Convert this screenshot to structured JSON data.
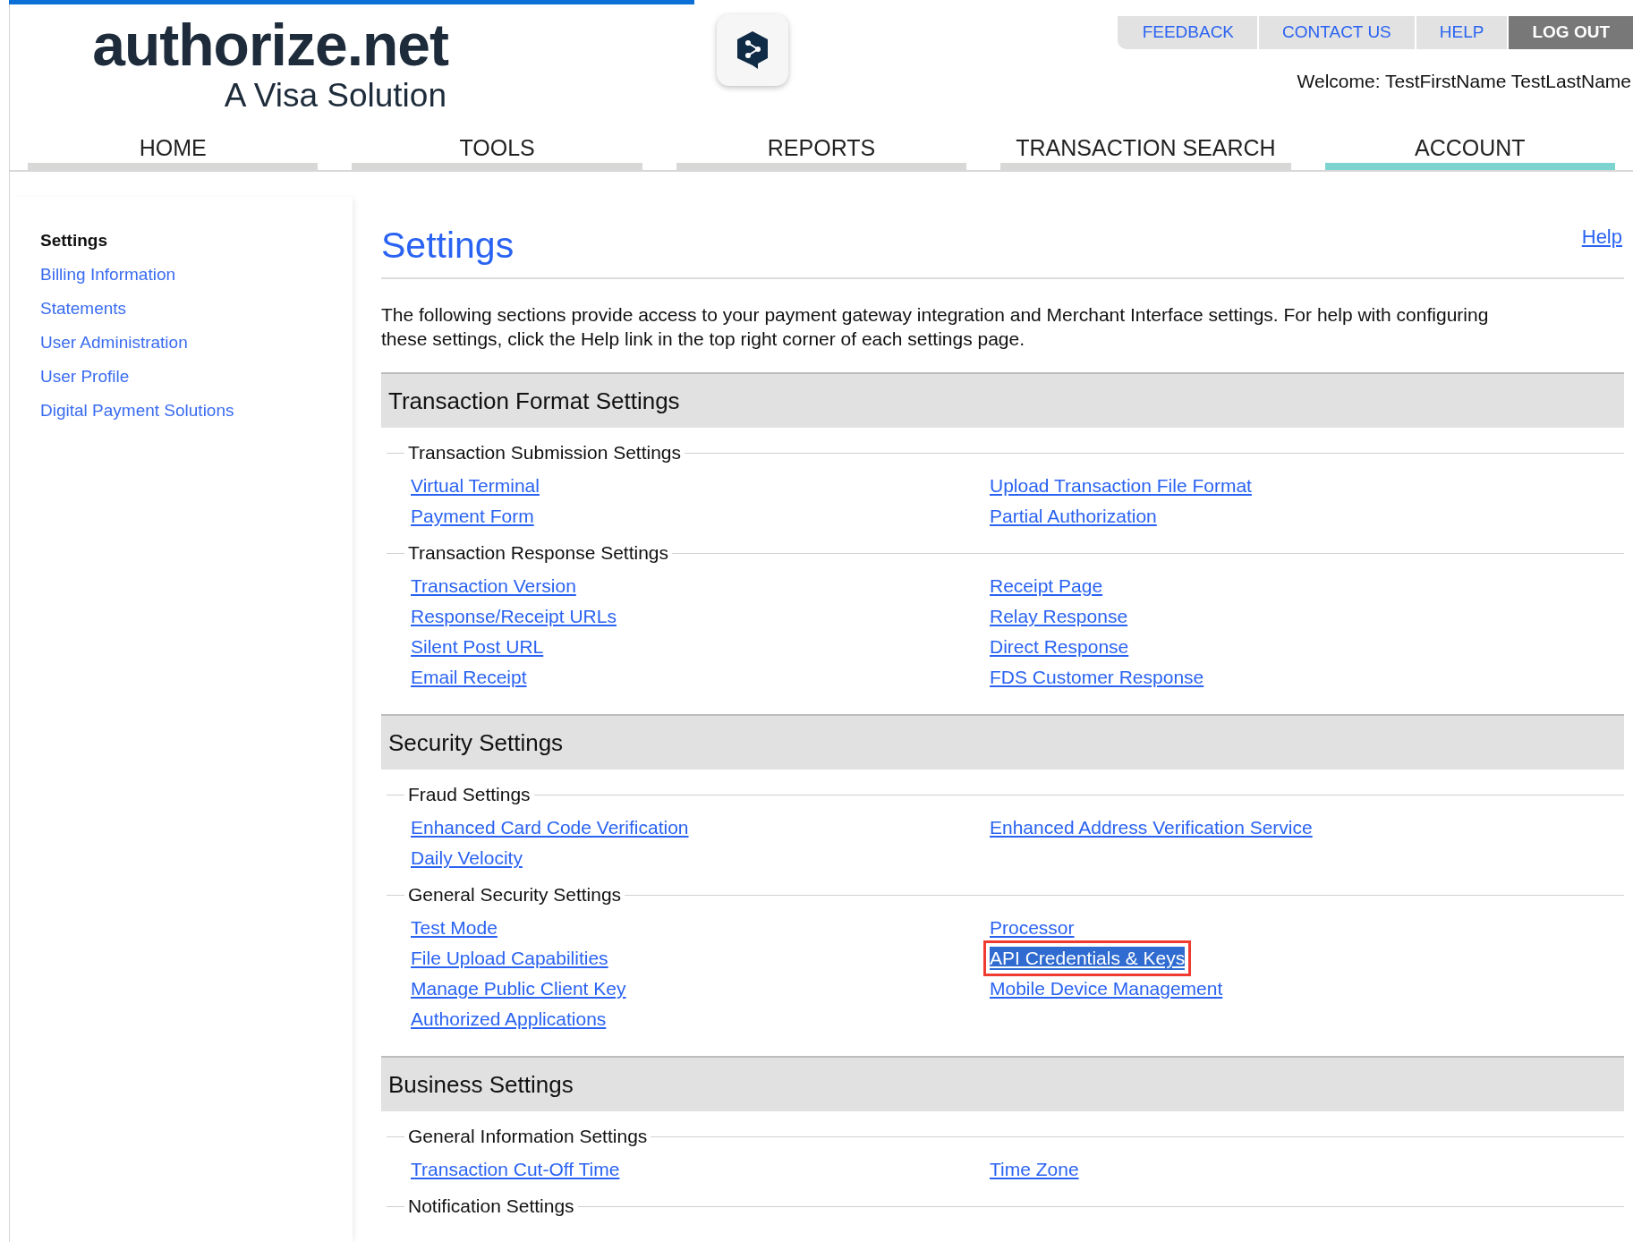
{
  "logo": {
    "name": "authorize.net",
    "tagline": "A Visa Solution"
  },
  "top_links": [
    {
      "label": "FEEDBACK",
      "kind": "link"
    },
    {
      "label": "CONTACT US",
      "kind": "link"
    },
    {
      "label": "HELP",
      "kind": "link"
    },
    {
      "label": "LOG OUT",
      "kind": "logout"
    }
  ],
  "welcome": "Welcome: TestFirstName TestLastName",
  "nav_tabs": [
    {
      "label": "HOME",
      "selected": false
    },
    {
      "label": "TOOLS",
      "selected": false
    },
    {
      "label": "REPORTS",
      "selected": false
    },
    {
      "label": "TRANSACTION SEARCH",
      "selected": false
    },
    {
      "label": "ACCOUNT",
      "selected": true
    }
  ],
  "sidebar": {
    "items": [
      {
        "label": "Settings",
        "selected": true
      },
      {
        "label": "Billing Information",
        "selected": false
      },
      {
        "label": "Statements",
        "selected": false
      },
      {
        "label": "User Administration",
        "selected": false
      },
      {
        "label": "User Profile",
        "selected": false
      },
      {
        "label": "Digital Payment Solutions",
        "selected": false
      }
    ]
  },
  "page": {
    "title": "Settings",
    "help_link": "Help",
    "description": "The following sections provide access to your payment gateway integration and Merchant Interface settings. For help with configuring these settings, click the Help link in the top right corner of each settings page."
  },
  "sections": [
    {
      "title": "Transaction Format Settings",
      "groups": [
        {
          "title": "Transaction Submission Settings",
          "left": [
            {
              "label": "Virtual Terminal",
              "highlighted": false
            },
            {
              "label": "Payment Form",
              "highlighted": false
            }
          ],
          "right": [
            {
              "label": "Upload Transaction File Format",
              "highlighted": false
            },
            {
              "label": "Partial Authorization",
              "highlighted": false
            }
          ]
        },
        {
          "title": "Transaction Response Settings",
          "left": [
            {
              "label": "Transaction Version",
              "highlighted": false
            },
            {
              "label": "Response/Receipt URLs",
              "highlighted": false
            },
            {
              "label": "Silent Post URL",
              "highlighted": false
            },
            {
              "label": "Email Receipt",
              "highlighted": false
            }
          ],
          "right": [
            {
              "label": "Receipt Page",
              "highlighted": false
            },
            {
              "label": "Relay Response",
              "highlighted": false
            },
            {
              "label": "Direct Response",
              "highlighted": false
            },
            {
              "label": "FDS Customer Response",
              "highlighted": false
            }
          ]
        }
      ]
    },
    {
      "title": "Security Settings",
      "groups": [
        {
          "title": "Fraud Settings",
          "left": [
            {
              "label": "Enhanced Card Code Verification",
              "highlighted": false
            },
            {
              "label": "Daily Velocity",
              "highlighted": false
            }
          ],
          "right": [
            {
              "label": "Enhanced Address Verification Service",
              "highlighted": false
            }
          ]
        },
        {
          "title": "General Security Settings",
          "left": [
            {
              "label": "Test Mode",
              "highlighted": false
            },
            {
              "label": "File Upload Capabilities",
              "highlighted": false
            },
            {
              "label": "Manage Public Client Key",
              "highlighted": false
            },
            {
              "label": "Authorized Applications",
              "highlighted": false
            }
          ],
          "right": [
            {
              "label": "Processor",
              "highlighted": false
            },
            {
              "label": "API Credentials & Keys",
              "highlighted": true
            },
            {
              "label": "Mobile Device Management",
              "highlighted": false
            }
          ]
        }
      ]
    },
    {
      "title": "Business Settings",
      "groups": [
        {
          "title": "General Information Settings",
          "left": [
            {
              "label": "Transaction Cut-Off Time",
              "highlighted": false
            }
          ],
          "right": [
            {
              "label": "Time Zone",
              "highlighted": false
            }
          ]
        },
        {
          "title": "Notification Settings"
        }
      ]
    }
  ]
}
